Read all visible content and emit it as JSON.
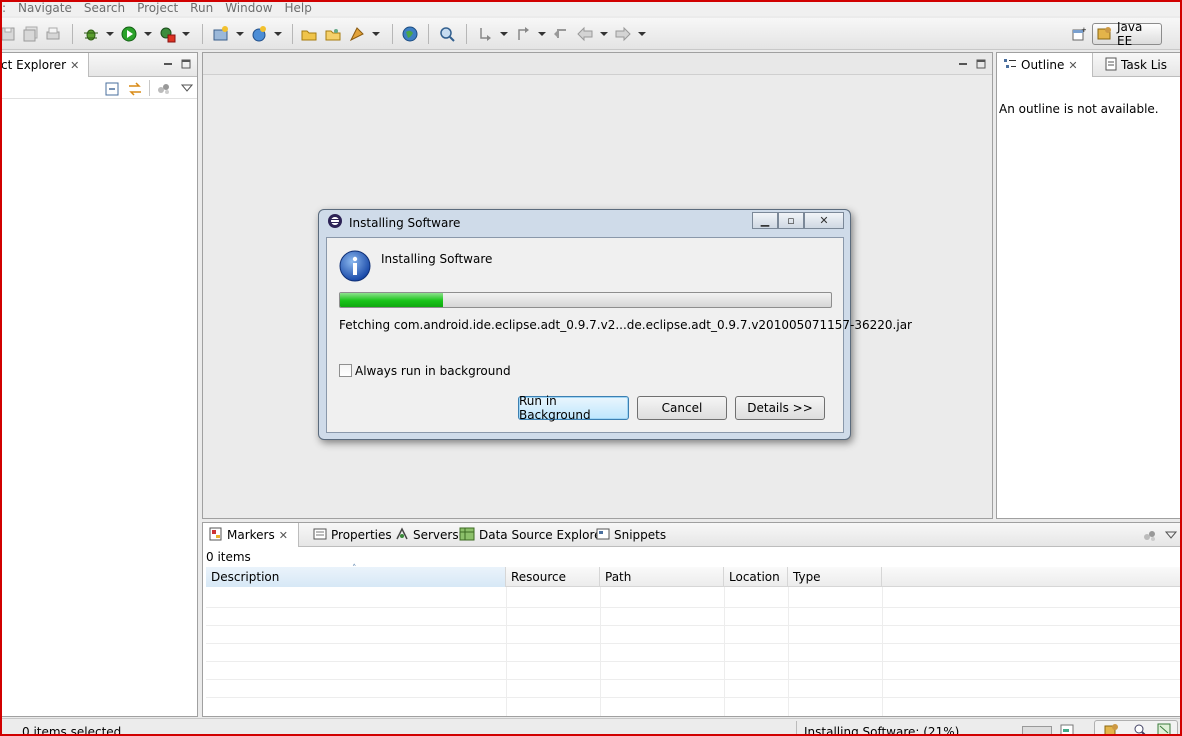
{
  "menu": {
    "items": [
      "Navigate",
      "Search",
      "Project",
      "Run",
      "Window",
      "Help"
    ]
  },
  "toolbar": {
    "perspective_label": "Java EE"
  },
  "project_explorer": {
    "tab_label": "ct Explorer"
  },
  "outline": {
    "tabs": [
      {
        "label": "Outline"
      },
      {
        "label": "Task Lis"
      }
    ],
    "message": "An outline is not available."
  },
  "bottom_panel": {
    "tabs": [
      {
        "label": "Markers"
      },
      {
        "label": "Properties"
      },
      {
        "label": "Servers"
      },
      {
        "label": "Data Source Explorer"
      },
      {
        "label": "Snippets"
      }
    ],
    "item_count": "0 items",
    "columns": [
      "Description",
      "Resource",
      "Path",
      "Location",
      "Type"
    ]
  },
  "status": {
    "left": "0 items selected",
    "right": "Installing Software: (21%)"
  },
  "dialog": {
    "window_title": "Installing Software",
    "heading": "Installing Software",
    "progress": 0.21,
    "detail": "Fetching com.android.ide.eclipse.adt_0.9.7.v2...de.eclipse.adt_0.9.7.v201005071157-36220.jar",
    "checkbox_label": "Always run in background",
    "buttons": {
      "run_background": "Run in Background",
      "cancel": "Cancel",
      "details": "Details >>"
    }
  },
  "colors": {
    "frame": "#d10000",
    "progress": "#18c418"
  }
}
